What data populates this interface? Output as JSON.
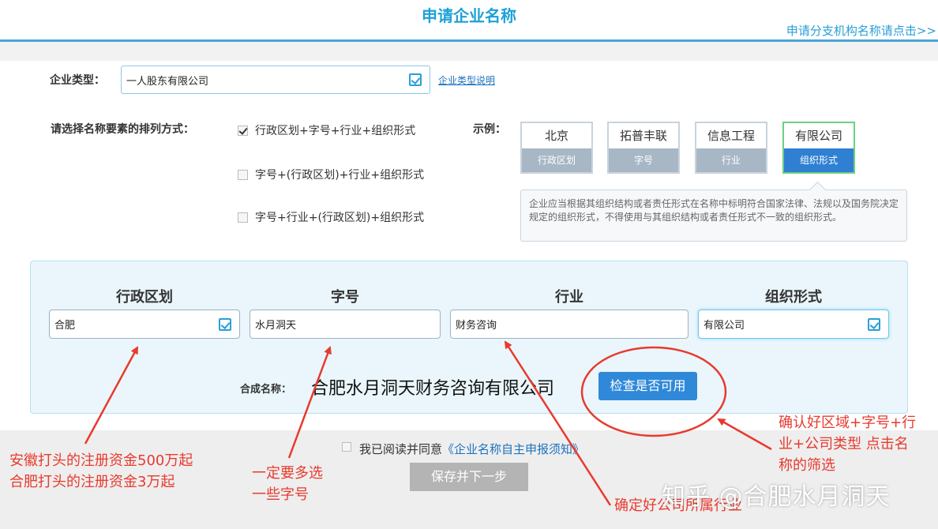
{
  "header": {
    "title": "申请企业名称",
    "branch_link": "申请分支机构名称请点击>>"
  },
  "company_type": {
    "label": "企业类型：",
    "value": "一人股东有限公司",
    "help_link": "企业类型说明"
  },
  "arrangement": {
    "label": "请选择名称要素的排列方式：",
    "options": [
      {
        "text": "行政区划+字号+行业+组织形式",
        "checked": true
      },
      {
        "text": "字号+(行政区划)+行业+组织形式",
        "checked": false
      },
      {
        "text": "字号+行业+(行政区划)+组织形式",
        "checked": false
      }
    ]
  },
  "example": {
    "label": "示例：",
    "cards": [
      {
        "value": "北京",
        "tag": "行政区划",
        "active": false
      },
      {
        "value": "拓普丰联",
        "tag": "字号",
        "active": false
      },
      {
        "value": "信息工程",
        "tag": "行业",
        "active": false
      },
      {
        "value": "有限公司",
        "tag": "组织形式",
        "active": true
      }
    ],
    "tip": "企业应当根据其组织结构或者责任形式在名称中标明符合国家法律、法规以及国务院决定规定的组织形式，不得使用与其组织结构或者责任形式不一致的组织形式。"
  },
  "name_form": {
    "columns": [
      {
        "header": "行政区划",
        "value": "合肥"
      },
      {
        "header": "字号",
        "value": "水月洞天"
      },
      {
        "header": "行业",
        "value": "财务咨询"
      },
      {
        "header": "组织形式",
        "value": "有限公司"
      }
    ],
    "combined_label": "合成名称：",
    "combined_value": "合肥水月洞天财务咨询有限公司",
    "check_button": "检查是否可用"
  },
  "agreement": {
    "prefix": "我已阅读并同意",
    "link": "《企业名称自主申报须知》"
  },
  "save_button": "保存并下一步",
  "annotations": {
    "left_line1": "安徽打头的注册资金500万起",
    "left_line2": "合肥打头的注册资金3万起",
    "mid_line1": "一定要多选",
    "mid_line2": "一些字号",
    "industry": "确定好公司所属行业",
    "right_line1": "确认好区域+字号+行",
    "right_line2": "业+公司类型 点击名",
    "right_line3": "称的筛选"
  },
  "watermark": "知乎 @合肥水月洞天",
  "colors": {
    "accent": "#1ea1d8",
    "button_blue": "#2f89d8",
    "annotation_red": "#e83a2e",
    "active_card_green": "#6ccf7f"
  }
}
